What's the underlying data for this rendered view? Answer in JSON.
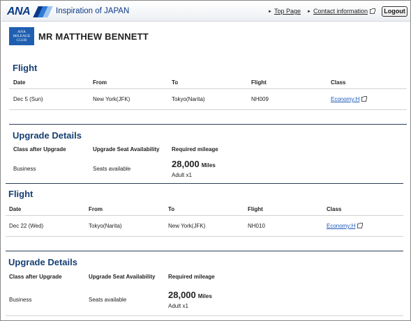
{
  "header": {
    "logo_text": "ANA",
    "tagline": "Inspiration of JAPAN",
    "top_page": "Top Page",
    "contact": "Contact information",
    "logout": "Logout"
  },
  "member": {
    "club_badge": "ANA MILEAGE CLUB",
    "name": "MR MATTHEW BENNETT"
  },
  "flight_headers": [
    "Date",
    "From",
    "To",
    "Flight",
    "Class"
  ],
  "upgrade_headers": [
    "Class after Upgrade",
    "Upgrade Seat Availability",
    "Required mileage"
  ],
  "segments": [
    {
      "flight_title": "Flight",
      "date": "Dec 5 (Sun)",
      "from": "New York(JFK)",
      "to": "Tokyo(Narita)",
      "flight": "NH009",
      "class": "Economy:H",
      "upgrade_title": "Upgrade Details",
      "class_after": "Business",
      "availability": "Seats available",
      "mileage": "28,000",
      "mileage_unit": "Miles",
      "passengers": "Adult x1"
    },
    {
      "flight_title": "Flight",
      "date": "Dec 22 (Wed)",
      "from": "Tokyo(Narita)",
      "to": "New York(JFK)",
      "flight": "NH010",
      "class": "Economy:H",
      "upgrade_title": "Upgrade Details",
      "class_after": "Business",
      "availability": "Seats available",
      "mileage": "28,000",
      "mileage_unit": "Miles",
      "passengers": "Adult x1"
    }
  ]
}
